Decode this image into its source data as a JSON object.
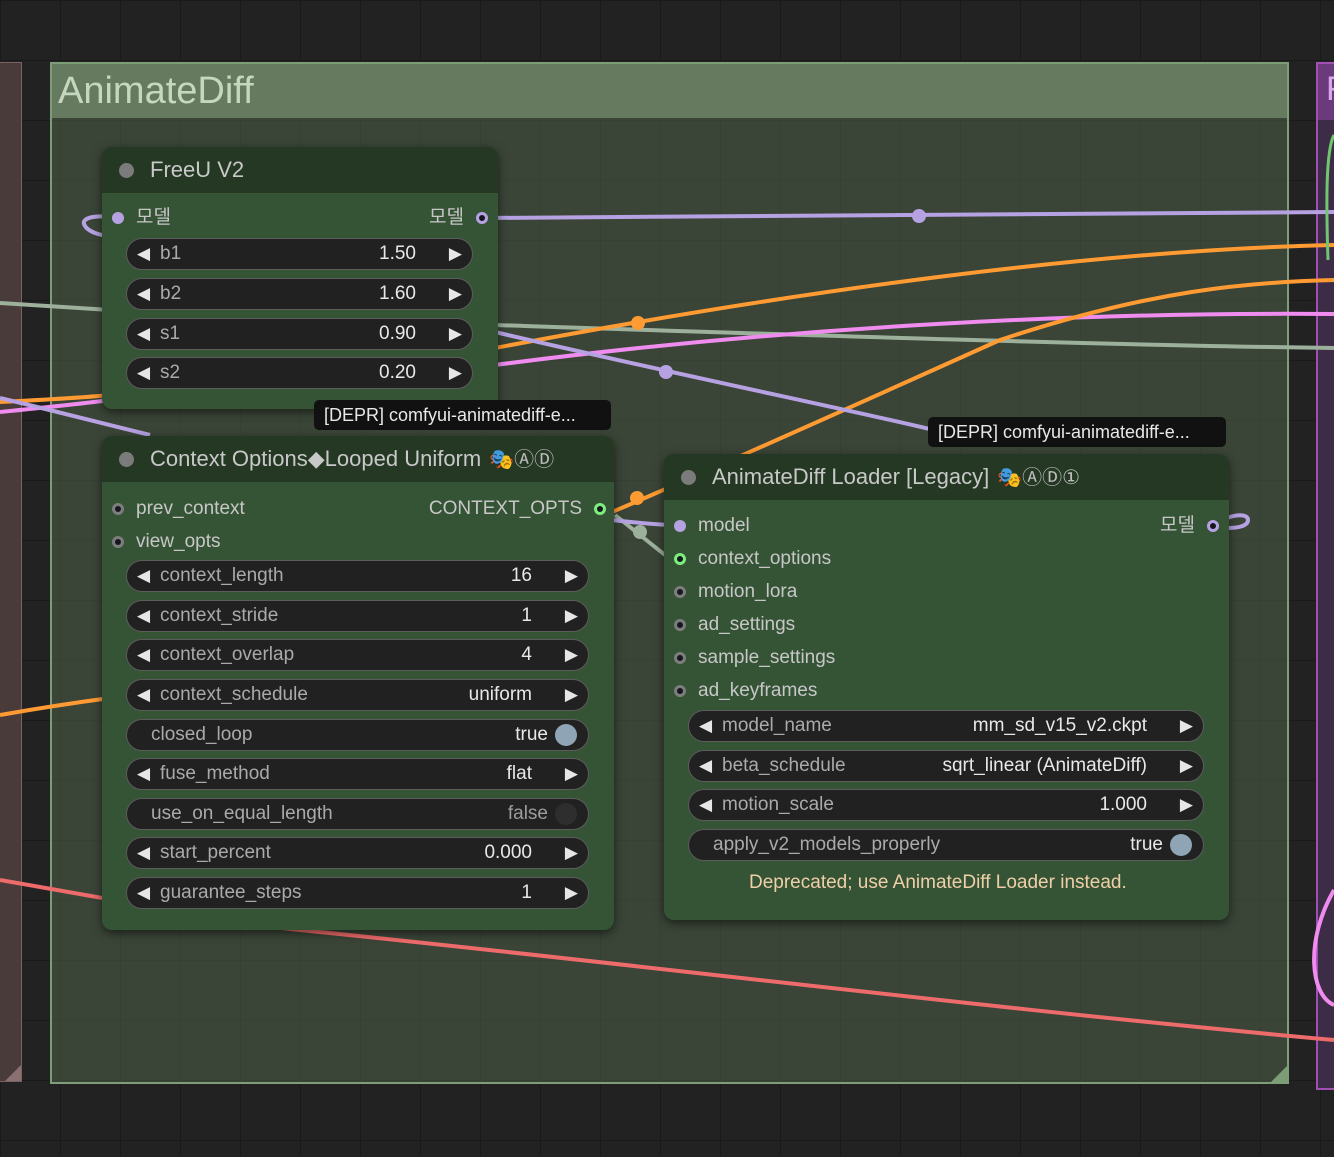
{
  "groups": {
    "main_title": "AnimateDiff",
    "right_title_partial": "F"
  },
  "icons": {
    "link": "link-icon",
    "badge_mask": "theater-mask-icon"
  },
  "colors": {
    "model_wire": "#b6a2e2",
    "orange_wire": "#ff9b32",
    "pink_wire": "#f08cf0",
    "sage_wire": "#9cb09c",
    "red_wire": "#ee6b6b",
    "node_body": "#355335",
    "node_title": "#243824",
    "warning_text": "#f0cfa8"
  },
  "freeu": {
    "title": "FreeU V2",
    "input_label": "모델",
    "output_label": "모델",
    "widgets": [
      {
        "name": "b1",
        "value": "1.50"
      },
      {
        "name": "b2",
        "value": "1.60"
      },
      {
        "name": "s1",
        "value": "0.90"
      },
      {
        "name": "s2",
        "value": "0.20"
      }
    ]
  },
  "tooltips": {
    "context": "[DEPR] comfyui-animatediff-e...",
    "loader": "[DEPR] comfyui-animatediff-e..."
  },
  "context": {
    "title": "Context Options◆Looped Uniform",
    "badge_circles": "ⒶⒹ",
    "inputs": [
      "prev_context",
      "view_opts"
    ],
    "output_label": "CONTEXT_OPTS",
    "widgets": {
      "context_length": {
        "name": "context_length",
        "value": "16"
      },
      "context_stride": {
        "name": "context_stride",
        "value": "1"
      },
      "context_overlap": {
        "name": "context_overlap",
        "value": "4"
      },
      "context_schedule": {
        "name": "context_schedule",
        "value": "uniform"
      },
      "closed_loop": {
        "name": "closed_loop",
        "value": "true"
      },
      "fuse_method": {
        "name": "fuse_method",
        "value": "flat"
      },
      "use_on_equal_length": {
        "name": "use_on_equal_length",
        "value": "false"
      },
      "start_percent": {
        "name": "start_percent",
        "value": "0.000"
      },
      "guarantee_steps": {
        "name": "guarantee_steps",
        "value": "1"
      }
    }
  },
  "loader": {
    "title": "AnimateDiff Loader [Legacy]",
    "badge_circles": "ⒶⒹ①",
    "inputs": [
      "model",
      "context_options",
      "motion_lora",
      "ad_settings",
      "sample_settings",
      "ad_keyframes"
    ],
    "output_label": "모델",
    "widgets": {
      "model_name": {
        "name": "model_name",
        "value": "mm_sd_v15_v2.ckpt"
      },
      "beta_schedule": {
        "name": "beta_schedule",
        "value": "sqrt_linear (AnimateDiff)"
      },
      "motion_scale": {
        "name": "motion_scale",
        "value": "1.000"
      },
      "apply_v2_models_properly": {
        "name": "apply_v2_models_properly",
        "value": "true"
      }
    },
    "warning": "Deprecated; use AnimateDiff Loader instead."
  }
}
